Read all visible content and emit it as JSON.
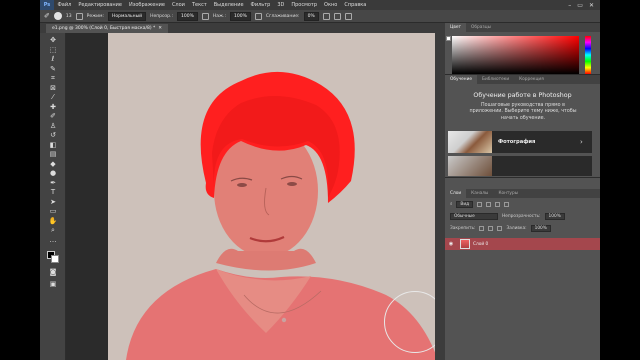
{
  "menubar": {
    "app_logo": "Ps",
    "items": [
      "Файл",
      "Редактирование",
      "Изображение",
      "Слои",
      "Текст",
      "Выделение",
      "Фильтр",
      "3D",
      "Просмотр",
      "Окно",
      "Справка"
    ],
    "window_controls": [
      "–",
      "▭",
      "✕"
    ]
  },
  "options_bar": {
    "brush_size": "13",
    "mode_label": "Режим:",
    "mode_value": "Нормальный",
    "opacity_label": "Непрозр.:",
    "opacity_value": "100%",
    "flow_label": "Наж.:",
    "flow_value": "100%",
    "smoothing_label": "Сглаживание:",
    "smoothing_value": "0%"
  },
  "document_tab": {
    "title": "e1.png @ 300% (Слой 0, Быстрая маска/8) *",
    "close": "✕"
  },
  "tools": [
    {
      "icon": "move-icon",
      "glyph": "✥"
    },
    {
      "icon": "marquee-icon",
      "glyph": "⬚"
    },
    {
      "icon": "lasso-icon",
      "glyph": "ℓ"
    },
    {
      "icon": "quick-select-icon",
      "glyph": "✎"
    },
    {
      "icon": "crop-icon",
      "glyph": "⌗"
    },
    {
      "icon": "frame-icon",
      "glyph": "⊠"
    },
    {
      "icon": "eyedropper-icon",
      "glyph": "⁄"
    },
    {
      "icon": "healing-icon",
      "glyph": "✚"
    },
    {
      "icon": "brush-icon",
      "glyph": "✐"
    },
    {
      "icon": "stamp-icon",
      "glyph": "♙"
    },
    {
      "icon": "history-brush-icon",
      "glyph": "↺"
    },
    {
      "icon": "eraser-icon",
      "glyph": "◧"
    },
    {
      "icon": "gradient-icon",
      "glyph": "▤"
    },
    {
      "icon": "blur-icon",
      "glyph": "◆"
    },
    {
      "icon": "dodge-icon",
      "glyph": "●"
    },
    {
      "icon": "pen-icon",
      "glyph": "✒"
    },
    {
      "icon": "type-icon",
      "glyph": "T"
    },
    {
      "icon": "path-select-icon",
      "glyph": "➤"
    },
    {
      "icon": "shape-icon",
      "glyph": "▭"
    },
    {
      "icon": "hand-icon",
      "glyph": "✋"
    },
    {
      "icon": "zoom-icon",
      "glyph": "⌕"
    },
    {
      "icon": "more-tools-icon",
      "glyph": "…"
    }
  ],
  "color_panel": {
    "tabs": [
      "Цвет",
      "Образцы"
    ],
    "hue_color": "#ff0000"
  },
  "learn_panel": {
    "tabs": [
      "Обучение",
      "Библиотеки",
      "Коррекция"
    ],
    "title": "Обучение работе в Photoshop",
    "description": "Пошаговые руководства прямо в приложении. Выберите тему ниже, чтобы начать обучение.",
    "card_label": "Фотография",
    "card_arrow": "›"
  },
  "layers_panel": {
    "tabs": [
      "Слои",
      "Каналы",
      "Контуры"
    ],
    "filter_label": "Вид",
    "blend_mode": "Обычные",
    "opacity_label": "Непрозрачность:",
    "opacity_value": "100%",
    "lock_label": "Закрепить:",
    "fill_label": "Заливка:",
    "fill_value": "100%",
    "layer_name": "Слой 0"
  }
}
